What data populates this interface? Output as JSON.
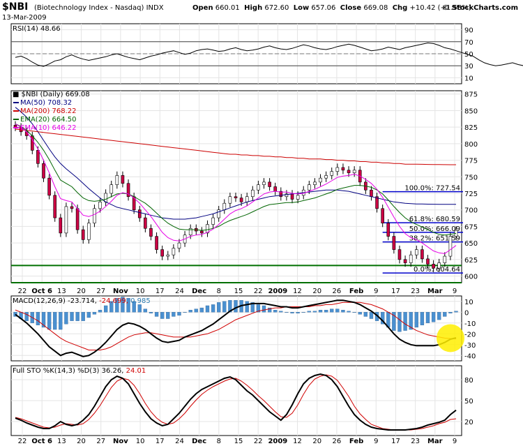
{
  "header": {
    "symbol": "$NBI",
    "name": "(Biotechnology Index - Nasdaq)",
    "exchange": "INDX",
    "date": "13-Mar-2009",
    "open_label": "Open",
    "open": "660.01",
    "high_label": "High",
    "high": "672.60",
    "low_label": "Low",
    "low": "657.06",
    "close_label": "Close",
    "close": "669.08",
    "chg_label": "Chg",
    "chg": "+10.42 (+1.58%)",
    "copyright": "© StockCharts.com"
  },
  "colors": {
    "ma50": "#000080",
    "ma200": "#cc0000",
    "ema20": "#006400",
    "ema10": "#e600e6",
    "up_candle": "#ffffff",
    "down_candle": "#cc0044",
    "macd_hist": "#4a90d0",
    "fib_line": "#0000cc",
    "support_line": "#007000",
    "highlight": "#ffee00"
  },
  "x_axis": {
    "labels": [
      "22",
      "Oct 6",
      "13",
      "20",
      "27",
      "Nov",
      "10",
      "17",
      "24",
      "Dec",
      "8",
      "15",
      "22",
      "2009",
      "12",
      "20",
      "26",
      "Feb",
      "9",
      "17",
      "23",
      "Mar",
      "9"
    ]
  },
  "chart_data": [
    {
      "type": "line",
      "title": "RSI(14)",
      "value_label": "48.66",
      "ylim": [
        0,
        100
      ],
      "y_ticks": [
        10,
        30,
        50,
        70,
        90
      ],
      "series": [
        {
          "name": "RSI(14)",
          "values": [
            44,
            46,
            42,
            36,
            31,
            29,
            33,
            38,
            40,
            45,
            48,
            44,
            41,
            39,
            41,
            43,
            45,
            48,
            50,
            47,
            44,
            42,
            40,
            43,
            46,
            48,
            51,
            53,
            55,
            52,
            49,
            51,
            55,
            57,
            58,
            56,
            54,
            55,
            58,
            60,
            57,
            55,
            56,
            58,
            61,
            63,
            60,
            58,
            57,
            59,
            62,
            65,
            63,
            60,
            58,
            57,
            59,
            62,
            64,
            66,
            64,
            61,
            58,
            55,
            56,
            58,
            61,
            59,
            57,
            60,
            62,
            64,
            66,
            68,
            67,
            64,
            60,
            58,
            55,
            52,
            49,
            46,
            40,
            35,
            32,
            30,
            31,
            33,
            35,
            32,
            30,
            36,
            44,
            48.66
          ]
        }
      ]
    },
    {
      "type": "line",
      "title": "$NBI (Daily)",
      "value_label": "669.08",
      "ylim": [
        590,
        880
      ],
      "y_ticks": [
        600,
        625,
        650,
        675,
        700,
        725,
        750,
        775,
        800,
        825,
        850,
        875
      ],
      "series": [
        {
          "name": "$NBI (Daily)",
          "values": [
            825,
            818,
            812,
            790,
            770,
            748,
            722,
            688,
            665,
            705,
            702,
            670,
            655,
            680,
            702,
            712,
            725,
            738,
            752,
            740,
            720,
            700,
            688,
            672,
            660,
            640,
            630,
            632,
            642,
            650,
            662,
            672,
            668,
            665,
            678,
            688,
            700,
            710,
            720,
            718,
            712,
            720,
            730,
            738,
            742,
            735,
            728,
            720,
            724,
            716,
            722,
            730,
            738,
            742,
            748,
            752,
            758,
            764,
            760,
            756,
            760,
            742,
            730,
            720,
            702,
            680,
            660,
            640,
            625,
            620,
            632,
            640,
            626,
            618,
            612,
            620,
            630,
            660,
            669.08
          ]
        },
        {
          "name": "MA(50)",
          "value_label": "708.32",
          "values": [
            855,
            848,
            840,
            830,
            818,
            805,
            792,
            780,
            770,
            762,
            755,
            748,
            740,
            732,
            725,
            718,
            712,
            708,
            704,
            702,
            700,
            698,
            696,
            694,
            692,
            690,
            688,
            687,
            686,
            686,
            686,
            687,
            688,
            690,
            692,
            694,
            697,
            700,
            703,
            706,
            709,
            712,
            714,
            716,
            718,
            720,
            721,
            722,
            723,
            724,
            725,
            726,
            727,
            728,
            729,
            730,
            730,
            730,
            729,
            728,
            726,
            724,
            722,
            720,
            718,
            716,
            714,
            712,
            711,
            710,
            709.5,
            709,
            708.8,
            708.6,
            708.5,
            708.4,
            708.35,
            708.33,
            708.32
          ]
        },
        {
          "name": "MA(200)",
          "value_label": "768.22",
          "values": [
            822,
            821,
            820,
            819,
            818,
            817,
            816,
            815,
            814,
            813,
            812,
            811,
            810,
            809,
            808,
            807,
            806,
            805,
            804,
            803,
            802,
            801,
            800,
            799,
            798,
            797,
            796,
            795,
            794,
            793,
            792,
            791,
            790,
            789,
            788,
            787,
            786,
            785,
            784,
            784,
            783,
            783,
            782,
            782,
            781,
            781,
            780,
            780,
            779,
            779,
            778,
            778,
            777,
            777,
            777,
            776,
            776,
            775,
            775,
            774,
            774,
            773,
            773,
            772,
            772,
            771,
            771,
            770,
            770,
            769,
            769,
            769,
            768.8,
            768.6,
            768.5,
            768.4,
            768.3,
            768.25,
            768.22
          ]
        },
        {
          "name": "EMA(20)",
          "value_label": "664.50",
          "values": [
            830,
            826,
            820,
            812,
            802,
            790,
            776,
            760,
            745,
            740,
            735,
            726,
            718,
            714,
            713,
            714,
            716,
            720,
            724,
            725,
            724,
            720,
            715,
            710,
            703,
            695,
            687,
            680,
            675,
            671,
            670,
            670,
            670,
            669,
            670,
            672,
            675,
            680,
            684,
            687,
            690,
            693,
            697,
            701,
            705,
            708,
            709,
            710,
            711,
            711,
            712,
            714,
            716,
            718,
            721,
            724,
            727,
            731,
            733,
            735,
            737,
            737,
            736,
            734,
            730,
            724,
            715,
            705,
            696,
            688,
            682,
            678,
            674,
            670,
            666,
            663,
            662,
            663,
            664.5
          ]
        },
        {
          "name": "EMA(10)",
          "value_label": "646.22",
          "values": [
            830,
            825,
            818,
            806,
            792,
            775,
            756,
            735,
            717,
            714,
            712,
            702,
            692,
            690,
            693,
            698,
            705,
            713,
            722,
            726,
            724,
            718,
            710,
            700,
            690,
            678,
            666,
            658,
            654,
            653,
            656,
            660,
            662,
            663,
            666,
            671,
            678,
            686,
            694,
            699,
            702,
            706,
            712,
            718,
            724,
            727,
            728,
            727,
            727,
            725,
            724,
            725,
            728,
            731,
            735,
            739,
            744,
            749,
            751,
            752,
            754,
            751,
            746,
            740,
            731,
            719,
            704,
            689,
            675,
            664,
            658,
            655,
            650,
            644,
            638,
            635,
            634,
            640,
            646.22
          ]
        }
      ],
      "fib_levels": [
        {
          "label": "100.0%: 727.54",
          "value": 727.54
        },
        {
          "label": "61.8%: 680.59",
          "value": 680.59
        },
        {
          "label": "50.0%: 666.09",
          "value": 666.09
        },
        {
          "label": "38.2%: 651.59",
          "value": 651.59
        },
        {
          "label": "0.0%: 604.64",
          "value": 604.64
        }
      ],
      "support_lines": [
        616,
        590
      ],
      "legend_placement": "top-left"
    },
    {
      "type": "line",
      "title": "MACD(12,26,9)",
      "values_label": [
        "-23.714",
        "-24.699",
        "0.985"
      ],
      "ylim": [
        -45,
        15
      ],
      "y_ticks": [
        10,
        0,
        -10,
        -20,
        -30,
        -40
      ],
      "series": [
        {
          "name": "MACD",
          "values": [
            -2,
            -6,
            -10,
            -15,
            -20,
            -26,
            -32,
            -36,
            -40,
            -38,
            -37,
            -39,
            -41,
            -40,
            -37,
            -33,
            -28,
            -22,
            -16,
            -12,
            -10,
            -11,
            -13,
            -16,
            -20,
            -24,
            -27,
            -28,
            -27,
            -26,
            -23,
            -21,
            -19,
            -17,
            -14,
            -11,
            -7,
            -3,
            1,
            4,
            6,
            7,
            8,
            8,
            8,
            7,
            6,
            5,
            5,
            4,
            4,
            5,
            6,
            7,
            8,
            9,
            10,
            11,
            11,
            10,
            9,
            7,
            4,
            1,
            -3,
            -8,
            -14,
            -20,
            -25,
            -28,
            -30,
            -31,
            -31,
            -31,
            -31,
            -30,
            -28,
            -25,
            -23.714
          ]
        },
        {
          "name": "Signal",
          "values": [
            2,
            0,
            -2,
            -5,
            -8,
            -12,
            -16,
            -20,
            -24,
            -27,
            -29,
            -31,
            -33,
            -35,
            -35,
            -35,
            -34,
            -32,
            -29,
            -26,
            -23,
            -21,
            -20,
            -19,
            -19,
            -20,
            -21,
            -22,
            -23,
            -23,
            -23,
            -23,
            -22,
            -21,
            -20,
            -18,
            -16,
            -13,
            -10,
            -7,
            -5,
            -3,
            -1,
            1,
            2,
            3,
            4,
            4,
            5,
            5,
            5,
            5,
            5,
            6,
            6,
            7,
            7,
            8,
            9,
            9,
            9,
            9,
            8,
            7,
            5,
            3,
            0,
            -3,
            -7,
            -11,
            -14,
            -17,
            -19,
            -21,
            -22,
            -23,
            -24,
            -24.4,
            -24.699
          ]
        },
        {
          "name": "Histogram",
          "values": [
            -4,
            -6,
            -8,
            -10,
            -12,
            -14,
            -16,
            -16,
            -16,
            -11,
            -8,
            -8,
            -8,
            -5,
            -2,
            2,
            6,
            10,
            13,
            14,
            13,
            10,
            7,
            3,
            -1,
            -4,
            -6,
            -6,
            -4,
            -3,
            0,
            2,
            3,
            4,
            6,
            7,
            9,
            10,
            11,
            11,
            11,
            10,
            9,
            7,
            6,
            4,
            2,
            1,
            0,
            -1,
            -1,
            0,
            1,
            1,
            2,
            2,
            3,
            3,
            2,
            1,
            0,
            -2,
            -4,
            -6,
            -8,
            -11,
            -14,
            -17,
            -18,
            -17,
            -16,
            -14,
            -12,
            -10,
            -9,
            -7,
            -4,
            -1,
            0.985
          ]
        }
      ]
    },
    {
      "type": "line",
      "title": "Full STO %K(14,3) %D(3)",
      "values_label": [
        "36.26",
        "24.01"
      ],
      "ylim": [
        0,
        100
      ],
      "y_ticks": [
        20,
        50,
        80
      ],
      "series": [
        {
          "name": "%K",
          "values": [
            25,
            22,
            18,
            15,
            12,
            10,
            10,
            14,
            20,
            16,
            14,
            16,
            22,
            30,
            42,
            56,
            70,
            80,
            85,
            82,
            74,
            60,
            46,
            34,
            24,
            18,
            14,
            16,
            24,
            32,
            42,
            52,
            60,
            66,
            70,
            74,
            78,
            82,
            84,
            80,
            72,
            64,
            58,
            50,
            42,
            34,
            28,
            22,
            30,
            44,
            60,
            74,
            82,
            86,
            88,
            86,
            80,
            70,
            56,
            42,
            30,
            22,
            16,
            12,
            10,
            9,
            8,
            8,
            8,
            8,
            9,
            10,
            12,
            15,
            17,
            19,
            22,
            30,
            36.26
          ]
        },
        {
          "name": "%D",
          "values": [
            26,
            24,
            21,
            18,
            15,
            12,
            11,
            12,
            15,
            17,
            16,
            15,
            17,
            23,
            32,
            43,
            56,
            69,
            78,
            82,
            80,
            72,
            60,
            46,
            34,
            25,
            19,
            16,
            18,
            24,
            32,
            42,
            51,
            59,
            65,
            70,
            74,
            78,
            81,
            82,
            78,
            72,
            65,
            57,
            50,
            42,
            34,
            27,
            26,
            32,
            44,
            59,
            72,
            81,
            85,
            87,
            85,
            79,
            68,
            56,
            42,
            31,
            23,
            16,
            13,
            10,
            9,
            8,
            8,
            8,
            8,
            9,
            10,
            12,
            14,
            17,
            19,
            23,
            24.01
          ]
        }
      ]
    }
  ]
}
